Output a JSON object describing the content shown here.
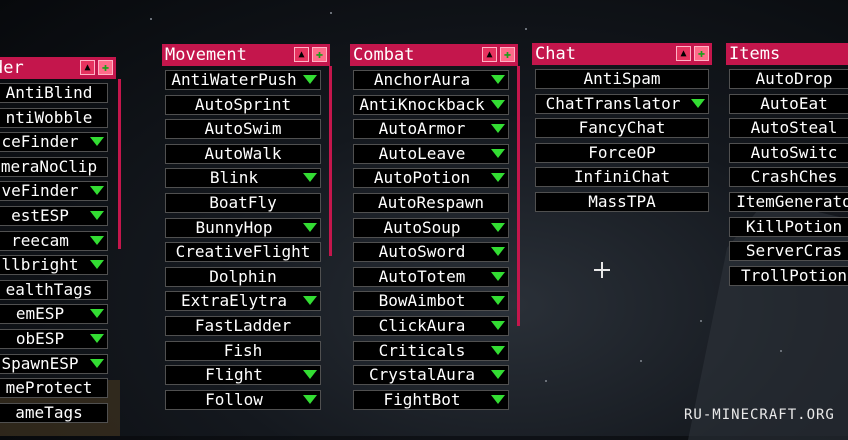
{
  "windows": {
    "render": {
      "title": "der",
      "items": [
        {
          "label": "AntiBlind",
          "arrow": false
        },
        {
          "label": "ntiWobble",
          "arrow": false
        },
        {
          "label": "ceFinder",
          "arrow": true
        },
        {
          "label": "meraNoClip",
          "arrow": false
        },
        {
          "label": "veFinder",
          "arrow": true
        },
        {
          "label": "estESP",
          "arrow": true
        },
        {
          "label": "reecam",
          "arrow": true
        },
        {
          "label": "llbright",
          "arrow": true
        },
        {
          "label": "ealthTags",
          "arrow": false
        },
        {
          "label": "emESP",
          "arrow": true
        },
        {
          "label": "obESP",
          "arrow": true
        },
        {
          "label": "SpawnESP",
          "arrow": true
        },
        {
          "label": "meProtect",
          "arrow": false
        },
        {
          "label": "ameTags",
          "arrow": false
        }
      ]
    },
    "movement": {
      "title": "Movement",
      "items": [
        {
          "label": "AntiWaterPush",
          "arrow": true
        },
        {
          "label": "AutoSprint",
          "arrow": false
        },
        {
          "label": "AutoSwim",
          "arrow": false
        },
        {
          "label": "AutoWalk",
          "arrow": false
        },
        {
          "label": "Blink",
          "arrow": true
        },
        {
          "label": "BoatFly",
          "arrow": false
        },
        {
          "label": "BunnyHop",
          "arrow": true
        },
        {
          "label": "CreativeFlight",
          "arrow": false
        },
        {
          "label": "Dolphin",
          "arrow": false
        },
        {
          "label": "ExtraElytra",
          "arrow": true
        },
        {
          "label": "FastLadder",
          "arrow": false
        },
        {
          "label": "Fish",
          "arrow": false
        },
        {
          "label": "Flight",
          "arrow": true
        },
        {
          "label": "Follow",
          "arrow": true
        }
      ]
    },
    "combat": {
      "title": "Combat",
      "items": [
        {
          "label": "AnchorAura",
          "arrow": true
        },
        {
          "label": "AntiKnockback",
          "arrow": true
        },
        {
          "label": "AutoArmor",
          "arrow": true
        },
        {
          "label": "AutoLeave",
          "arrow": true
        },
        {
          "label": "AutoPotion",
          "arrow": true
        },
        {
          "label": "AutoRespawn",
          "arrow": false
        },
        {
          "label": "AutoSoup",
          "arrow": true
        },
        {
          "label": "AutoSword",
          "arrow": true
        },
        {
          "label": "AutoTotem",
          "arrow": true
        },
        {
          "label": "BowAimbot",
          "arrow": true
        },
        {
          "label": "ClickAura",
          "arrow": true
        },
        {
          "label": "Criticals",
          "arrow": true
        },
        {
          "label": "CrystalAura",
          "arrow": true
        },
        {
          "label": "FightBot",
          "arrow": true
        }
      ]
    },
    "chat": {
      "title": "Chat",
      "items": [
        {
          "label": "AntiSpam",
          "arrow": false
        },
        {
          "label": "ChatTranslator",
          "arrow": true
        },
        {
          "label": "FancyChat",
          "arrow": false
        },
        {
          "label": "ForceOP",
          "arrow": false
        },
        {
          "label": "InfiniChat",
          "arrow": false
        },
        {
          "label": "MassTPA",
          "arrow": false
        }
      ]
    },
    "items": {
      "title": "Items",
      "items": [
        {
          "label": "AutoDrop",
          "arrow": false
        },
        {
          "label": "AutoEat",
          "arrow": false
        },
        {
          "label": "AutoSteal",
          "arrow": false
        },
        {
          "label": "AutoSwitc",
          "arrow": false
        },
        {
          "label": "CrashChes",
          "arrow": false
        },
        {
          "label": "ItemGenerato",
          "arrow": false
        },
        {
          "label": "KillPotion",
          "arrow": false
        },
        {
          "label": "ServerCras",
          "arrow": false
        },
        {
          "label": "TrollPotion",
          "arrow": false
        }
      ]
    }
  },
  "header_buttons": {
    "minimize_glyph": "▲",
    "pin_glyph": "📌"
  },
  "watermark": "RU-MINECRAFT.ORG",
  "colors": {
    "accent": "#c4164c",
    "arrow": "#33dd33",
    "item_bg": "#000000"
  }
}
